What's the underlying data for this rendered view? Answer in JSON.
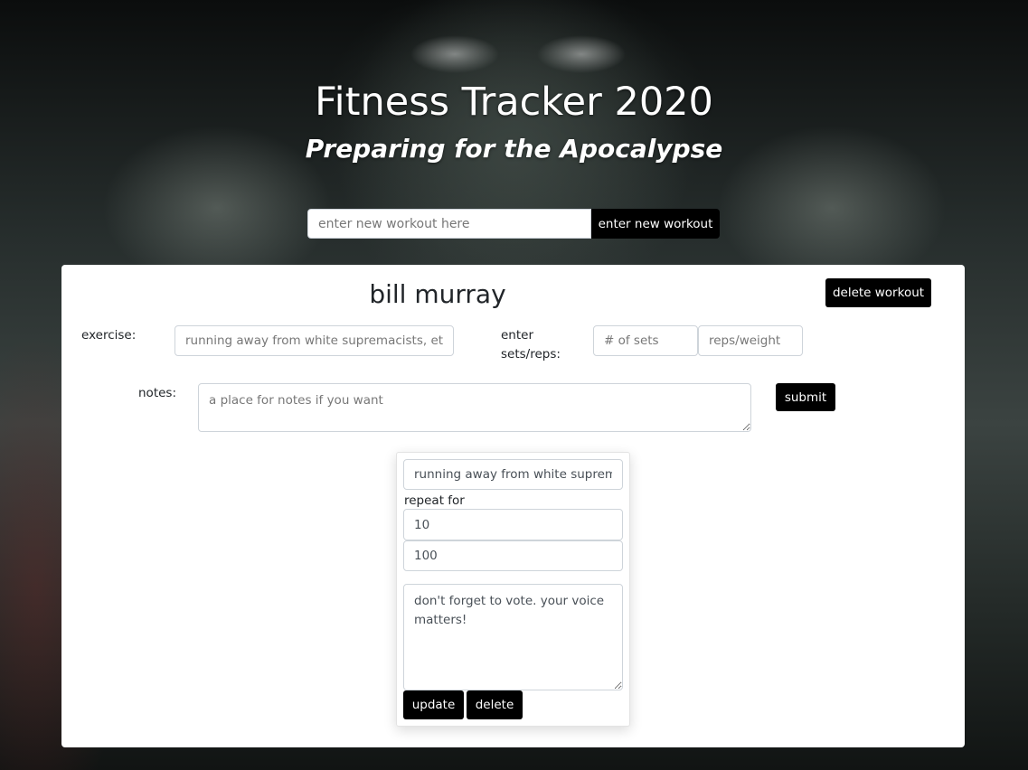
{
  "header": {
    "title": "Fitness Tracker 2020",
    "subtitle": "Preparing for the Apocalypse"
  },
  "new_workout": {
    "placeholder": "enter new workout here",
    "button_label": "enter new workout"
  },
  "workout": {
    "name": "bill murray",
    "delete_label": "delete workout",
    "exercise_label": "exercise:",
    "exercise_placeholder": "running away from white supremacists, etc.",
    "sets_reps_label": "enter sets/reps:",
    "sets_placeholder": "# of sets",
    "reps_placeholder": "reps/weight",
    "notes_label": "notes:",
    "notes_placeholder": "a place for notes if you want",
    "submit_label": "submit"
  },
  "entry": {
    "exercise_value": "running away from white supremacists, etc.",
    "repeat_label": "repeat for",
    "sets_value": "10",
    "reps_value": "100",
    "notes_value": "don't forget to vote. your voice matters!",
    "update_label": "update",
    "delete_label": "delete"
  }
}
